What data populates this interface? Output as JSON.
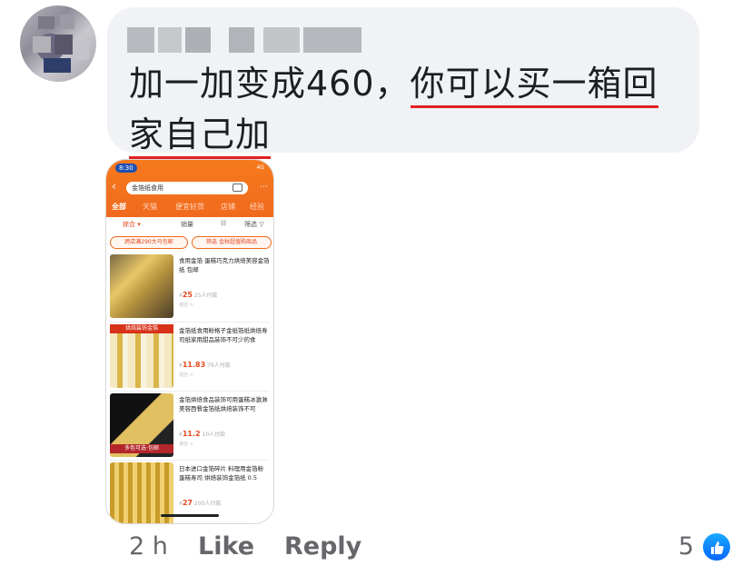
{
  "comment": {
    "text_plain": "加一加变成460，",
    "text_underlined_1": "你可以买一箱回",
    "text_underlined_2": "家自己加"
  },
  "screenshot": {
    "status_time": "8:30",
    "status_right": "4G",
    "search_value": "金箔纸食用",
    "tabs": [
      "全部",
      "天猫",
      "便宜好货",
      "店铺",
      "经验"
    ],
    "filters": [
      "综合 ▾",
      "销量",
      "☷",
      "筛选 ▽"
    ],
    "chips": [
      "跨店满290大马包邮",
      "筛选 金秋超值购商品"
    ],
    "items": [
      {
        "desc": "食用金箔 蛋糕巧克力烘焙美容金箔纸 包邮",
        "price": "25",
        "sales": "25人付款",
        "shop": "进店 >",
        "band": ""
      },
      {
        "desc": "金箔纸食用粉格子金纸箔纸烘焙寿司纸家用甜品装饰不可少的食",
        "price": "11.83",
        "sales": "79人付款",
        "shop": "进店 >",
        "band": "烘焙装饰金箔"
      },
      {
        "desc": "金箔烘焙食品装饰可用蛋糕冰激淋美容西餐金箔纸烘焙装饰不可",
        "price": "11.2",
        "sales": "10人付款",
        "shop": "进店 >",
        "band": "多色可选·包邮"
      },
      {
        "desc": "日本进口金箔碎片 料理用金箔粉 蛋糕寿司 烘焙装饰金箔纸 0.5",
        "price": "27",
        "sales": "200人付款",
        "shop": "",
        "band": ""
      }
    ]
  },
  "actions": {
    "time": "2 h",
    "like": "Like",
    "reply": "Reply",
    "reaction_count": "5"
  },
  "colors": {
    "underline": "#e02020",
    "bubble": "#f0f2f5",
    "taobao_orange": "#f06a1e",
    "like_blue": "#0866ff"
  }
}
